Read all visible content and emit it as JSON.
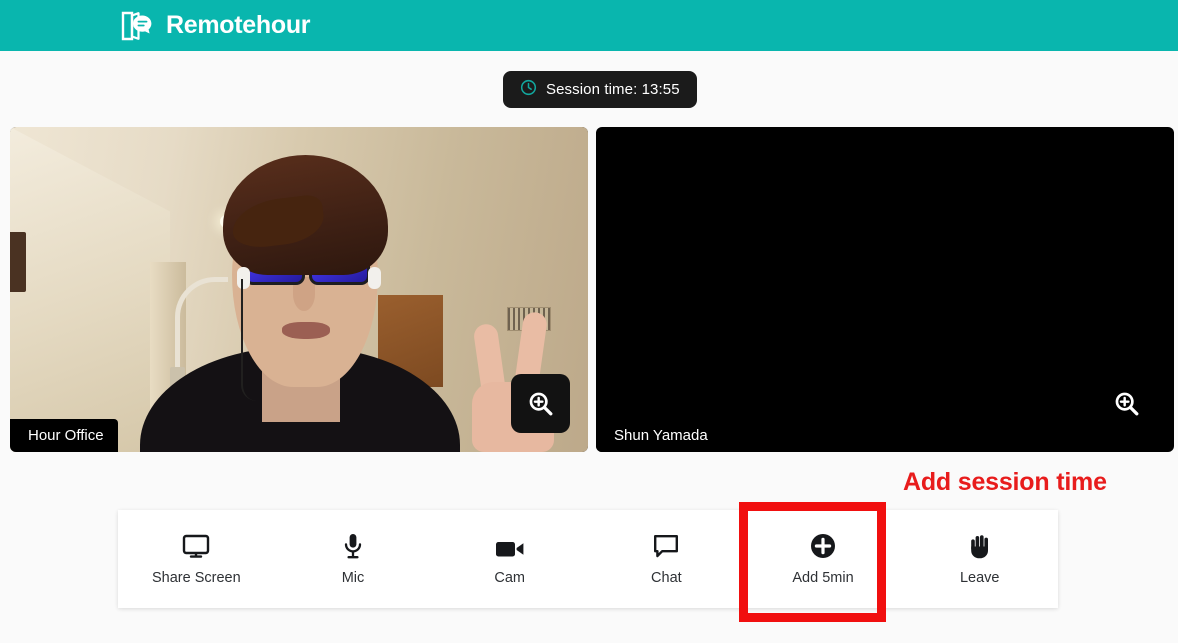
{
  "header": {
    "brand_name": "Remotehour",
    "logo_icon": "door-speech-bubble-icon",
    "background_color": "#09b6ae"
  },
  "session": {
    "icon": "clock-icon",
    "text": "Session time: 13:55",
    "time": "13:55",
    "background_color": "#1b1b1b",
    "icon_color": "#12a69d"
  },
  "video_tiles": [
    {
      "name": "Hour Office",
      "zoom_icon": "magnifier-plus-icon",
      "state": "video-on"
    },
    {
      "name": "Shun Yamada",
      "zoom_icon": "magnifier-plus-icon",
      "state": "video-off"
    }
  ],
  "annotation": {
    "text": "Add session time",
    "color": "#e81c1c"
  },
  "highlight": {
    "target": "Add 5min",
    "color": "#f10f0f"
  },
  "toolbar": {
    "items": [
      {
        "label": "Share Screen",
        "icon": "monitor-icon"
      },
      {
        "label": "Mic",
        "icon": "microphone-icon"
      },
      {
        "label": "Cam",
        "icon": "video-camera-icon"
      },
      {
        "label": "Chat",
        "icon": "speech-bubble-icon"
      },
      {
        "label": "Add 5min",
        "icon": "plus-circle-icon"
      },
      {
        "label": "Leave",
        "icon": "raised-hand-icon"
      }
    ]
  }
}
